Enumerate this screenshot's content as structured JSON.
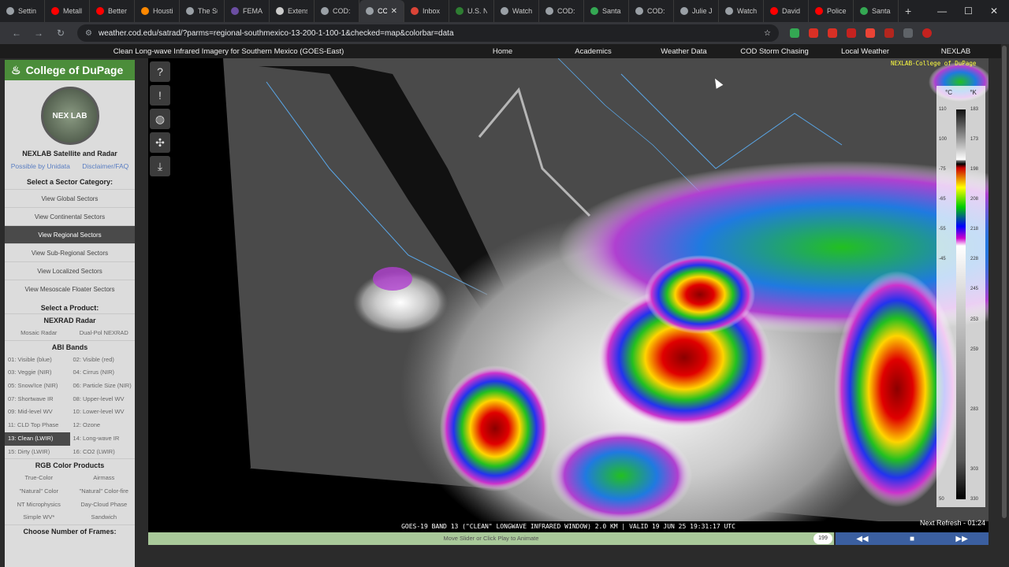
{
  "browser": {
    "tabs": [
      {
        "label": "Settin",
        "color": "#9aa0a6"
      },
      {
        "label": "Metall",
        "color": "#ff0000"
      },
      {
        "label": "Better",
        "color": "#ff0000"
      },
      {
        "label": "Housti",
        "color": "#ff8800"
      },
      {
        "label": "The Su",
        "color": "#9aa0a6"
      },
      {
        "label": "FEMA",
        "color": "#6b4ea2"
      },
      {
        "label": "Extens",
        "color": "#cccccc"
      },
      {
        "label": "COD: S",
        "color": "#9aa0a6"
      },
      {
        "label": "CC",
        "color": "#9aa0a6",
        "active": true
      },
      {
        "label": "Inbox",
        "color": "#db4437"
      },
      {
        "label": "U.S. N",
        "color": "#2e7d32"
      },
      {
        "label": "Watch",
        "color": "#9aa0a6"
      },
      {
        "label": "COD: S",
        "color": "#9aa0a6"
      },
      {
        "label": "Santa",
        "color": "#34a853"
      },
      {
        "label": "COD: S",
        "color": "#9aa0a6"
      },
      {
        "label": "Julie Ju",
        "color": "#9aa0a6"
      },
      {
        "label": "Watch",
        "color": "#9aa0a6"
      },
      {
        "label": "David",
        "color": "#ff0000"
      },
      {
        "label": "Police",
        "color": "#ff0000"
      },
      {
        "label": "Santa",
        "color": "#34a853"
      }
    ],
    "url": "weather.cod.edu/satrad/?parms=regional-southmexico-13-200-1-100-1&checked=map&colorbar=data"
  },
  "page": {
    "title": "Clean Long-wave Infrared Imagery for Southern Mexico (GOES-East)",
    "nav": [
      "Home",
      "Academics",
      "Weather Data",
      "COD Storm Chasing",
      "Local Weather",
      "NEXLAB"
    ]
  },
  "sidebar": {
    "brand": "College of DuPage",
    "logo_text": "NEX LAB",
    "title": "NEXLAB Satellite and Radar",
    "link_left": "Possible by Unidata",
    "link_right": "Disclaimer/FAQ",
    "sector_heading": "Select a Sector Category:",
    "sectors": [
      "View Global Sectors",
      "View Continental Sectors",
      "View Regional Sectors",
      "View Sub-Regional Sectors",
      "View Localized Sectors",
      "View Mesoscale Floater Sectors"
    ],
    "selected_sector": 2,
    "product_heading": "Select a Product:",
    "nexrad_heading": "NEXRAD Radar",
    "nexrad": [
      "Mosaic Radar",
      "Dual-Pol NEXRAD"
    ],
    "abi_heading": "ABI Bands",
    "abi": [
      "01: Visible (blue)",
      "02: Visible (red)",
      "03: Veggie (NIR)",
      "04: Cirrus (NIR)",
      "05: Snow/Ice (NIR)",
      "06: Particle Size (NIR)",
      "07: Shortwave IR",
      "08: Upper-level WV",
      "09: Mid-level WV",
      "10: Lower-level WV",
      "11: CLD Top Phase",
      "12: Ozone",
      "13: Clean (LWIR)",
      "14: Long-wave IR",
      "15: Dirty (LWIR)",
      "16: CO2 (LWIR)"
    ],
    "selected_abi": 12,
    "rgb_heading": "RGB Color Products",
    "rgb": [
      "True-Color",
      "Airmass",
      "\"Natural\" Color",
      "\"Natural\" Color-fire",
      "NT Microphysics",
      "Day-Cloud Phase",
      "Simple WV*",
      "Sandwich"
    ],
    "frames_heading": "Choose Number of Frames:"
  },
  "map": {
    "top_label": "NEXLAB-College of DuPage",
    "caption": "GOES-19 BAND 13 (\"CLEAN\" LONGWAVE INFRARED WINDOW) 2.0 KM | VALID 19 JUN 25 19:31:17 UTC",
    "next_refresh": "Next Refresh - 01:24"
  },
  "colorbar": {
    "unit_c": "°C",
    "unit_k": "°K",
    "ticks_c": [
      "110",
      "100",
      "-75",
      "-65",
      "-55",
      "-45",
      "",
      "",
      "",
      "",
      "",
      "",
      "",
      "50"
    ],
    "ticks_k": [
      "183",
      "173",
      "198",
      "208",
      "218",
      "228",
      "245",
      "253",
      "259",
      "",
      "283",
      "",
      "303",
      "330"
    ]
  },
  "slider": {
    "hint": "Move Slider or Click Play to Animate",
    "frame": "199",
    "controls": [
      "◀◀",
      "■",
      "▶▶"
    ]
  }
}
